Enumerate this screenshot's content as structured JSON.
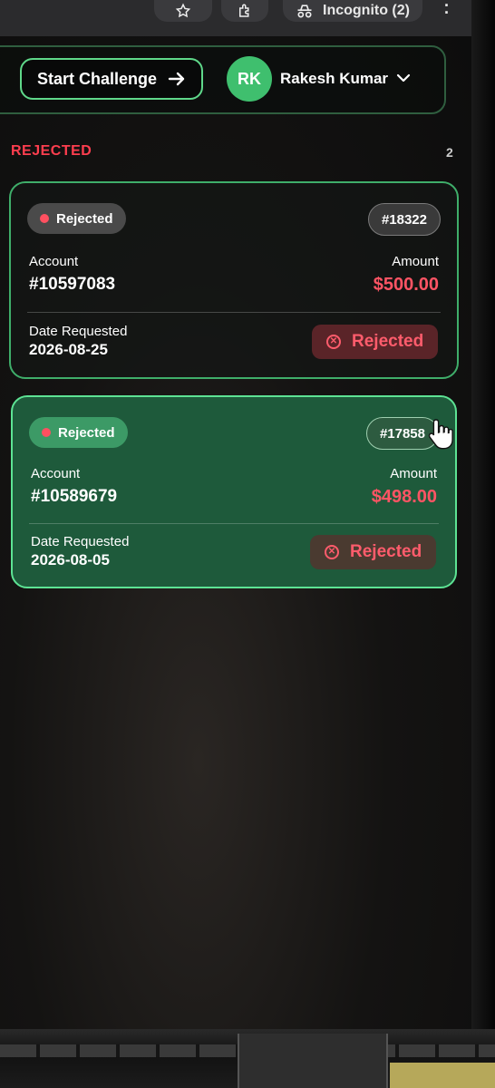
{
  "browser": {
    "incognito_label": "Incognito (2)"
  },
  "header": {
    "start_button_label": "Start Challenge",
    "avatar_initials": "RK",
    "user_name": "Rakesh Kumar"
  },
  "section": {
    "title": "REJECTED",
    "count": "2"
  },
  "requests": [
    {
      "status": "Rejected",
      "request_id": "#18322",
      "account_label": "Account",
      "account_number": "#10597083",
      "amount_label": "Amount",
      "amount": "$500.00",
      "date_label": "Date Requested",
      "date": "2026-08-25",
      "status_badge": "Rejected"
    },
    {
      "status": "Rejected",
      "request_id": "#17858",
      "account_label": "Account",
      "account_number": "#10589679",
      "amount_label": "Amount",
      "amount": "$498.00",
      "date_label": "Date Requested",
      "date": "2026-08-05",
      "status_badge": "Rejected"
    }
  ],
  "colors": {
    "accent_green": "#3fbf6e",
    "reject_red": "#ff5464",
    "section_red": "#ff3e4f"
  }
}
